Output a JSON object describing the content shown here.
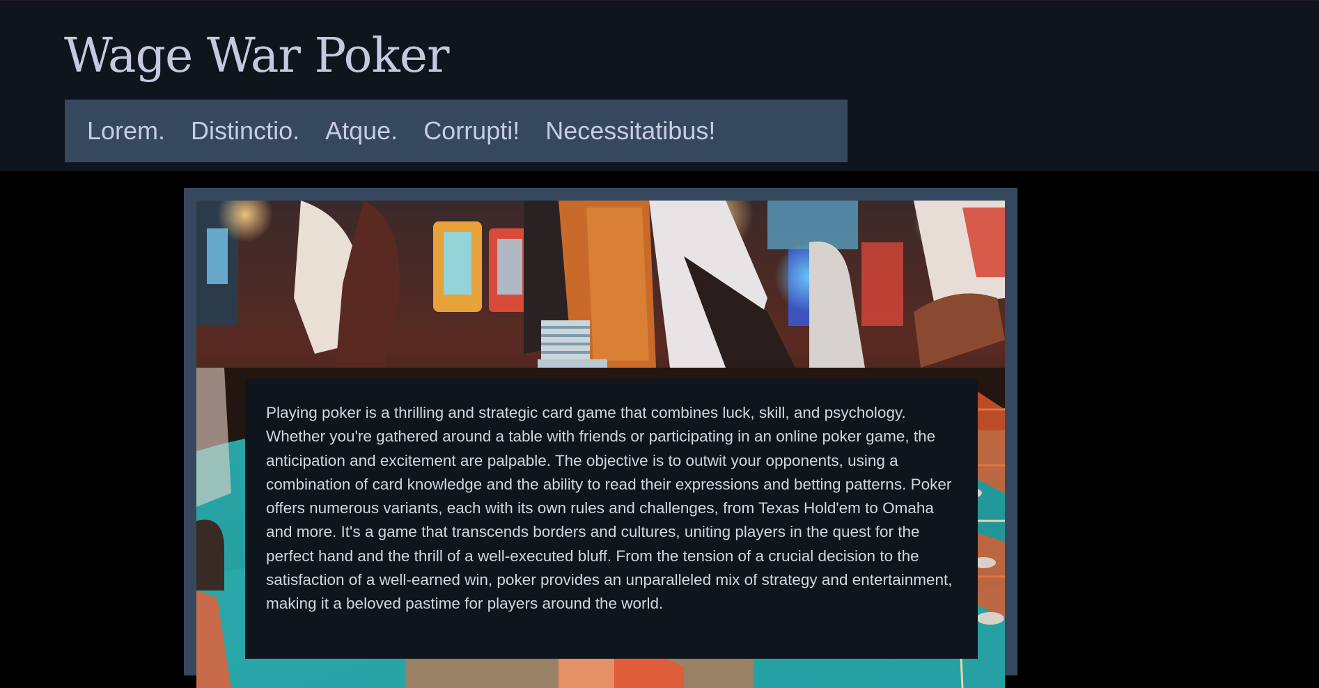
{
  "site": {
    "title": "Wage War Poker"
  },
  "nav": {
    "items": [
      {
        "label": "Lorem."
      },
      {
        "label": "Distinctio."
      },
      {
        "label": "Atque."
      },
      {
        "label": "Corrupti!"
      },
      {
        "label": "Necessitatibus!"
      }
    ]
  },
  "hero": {
    "image_subject": "casino poker table with chip stacks and players",
    "paragraph": "Playing poker is a thrilling and strategic card game that combines luck, skill, and psychology. Whether you're gathered around a table with friends or participating in an online poker game, the anticipation and excitement are palpable. The objective is to outwit your opponents, using a combination of card knowledge and the ability to read their expressions and betting patterns. Poker offers numerous variants, each with its own rules and challenges, from Texas Hold'em to Omaha and more. It's a game that transcends borders and cultures, uniting players in the quest for the perfect hand and the thrill of a well-executed bluff. From the tension of a crucial decision to the satisfaction of a well-earned win, poker provides an unparalleled mix of strategy and entertainment, making it a beloved pastime for players around the world."
  },
  "colors": {
    "page_background": "#000000",
    "header_background": "#0e151d",
    "nav_background": "#36485e",
    "title_text": "#c7c8de",
    "nav_text": "#c7cde0",
    "card_background": "#0e151d",
    "card_text": "#d3d6e2",
    "frame": "#36485e"
  }
}
